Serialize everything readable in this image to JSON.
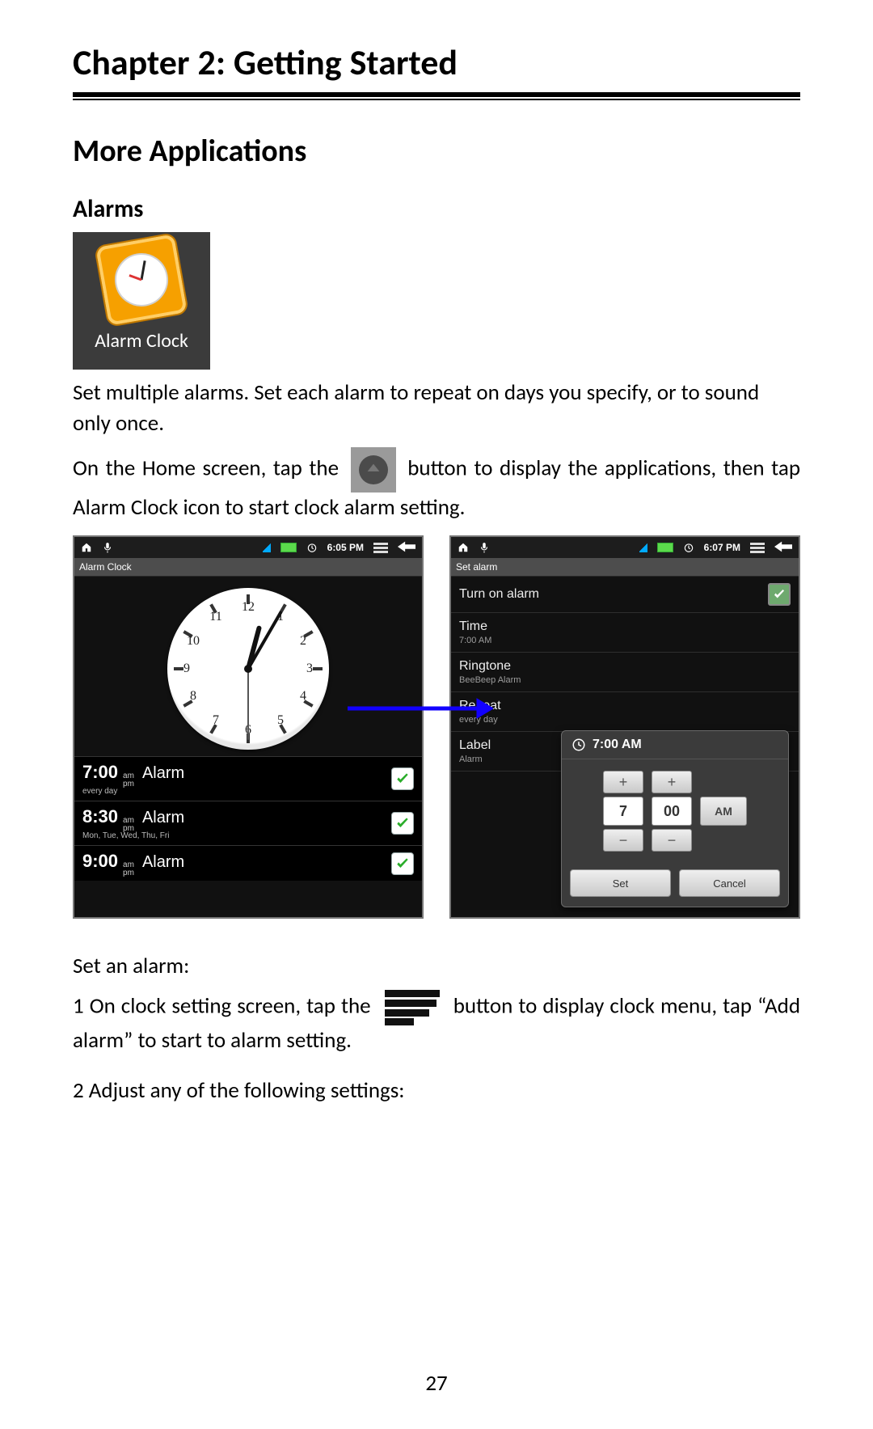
{
  "chapter_title": "Chapter 2: Getting Started",
  "section_title": "More Applications",
  "subsection_title": "Alarms",
  "app_tile_label": "Alarm Clock",
  "para1": "Set multiple alarms. Set each alarm to repeat on days you specify, or to sound only once.",
  "para2_a": "On the Home screen, tap the",
  "para2_b": "button to display the applications, then tap Alarm Clock icon to start clock alarm setting.",
  "set_alarm_heading": "Set an alarm:",
  "step1_a": "1 On clock setting screen, tap the",
  "step1_b": "button to display clock menu, tap “Add alarm” to start to alarm setting.",
  "step2": "2 Adjust any of the following settings:",
  "page_number": "27",
  "left_screen": {
    "status_time": "6:05 PM",
    "title": "Alarm Clock",
    "clock_numbers": [
      "12",
      "1",
      "2",
      "3",
      "4",
      "5",
      "6",
      "7",
      "8",
      "9",
      "10",
      "11"
    ],
    "alarms": [
      {
        "time": "7:00",
        "ampm_top": "am",
        "ampm_bot": "pm",
        "label": "Alarm",
        "days": "every day"
      },
      {
        "time": "8:30",
        "ampm_top": "am",
        "ampm_bot": "pm",
        "label": "Alarm",
        "days": "Mon, Tue, Wed, Thu, Fri"
      },
      {
        "time": "9:00",
        "ampm_top": "am",
        "ampm_bot": "pm",
        "label": "Alarm",
        "days": ""
      }
    ]
  },
  "right_screen": {
    "status_time": "6:07 PM",
    "title": "Set alarm",
    "items": {
      "turn_on": "Turn on alarm",
      "time": "Time",
      "time_sub": "7:00 AM",
      "ringtone": "Ringtone",
      "ringtone_sub": "BeeBeep Alarm",
      "repeat": "Repeat",
      "repeat_sub": "every day",
      "label": "Label",
      "label_sub": "Alarm"
    },
    "dialog": {
      "title": "7:00 AM",
      "hour": "7",
      "minute": "00",
      "ampm": "AM",
      "set": "Set",
      "cancel": "Cancel"
    }
  }
}
